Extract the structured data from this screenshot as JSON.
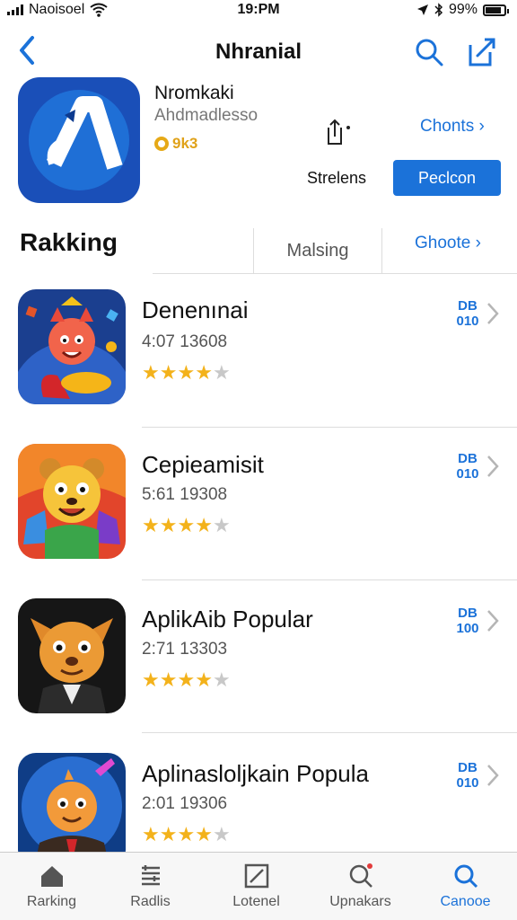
{
  "status_bar": {
    "carrier": "Naoisoel",
    "time": "19:PM",
    "battery": "99%",
    "icons": [
      "signal-bars-icon",
      "wifi-icon",
      "location-arrow-icon",
      "bluetooth-icon",
      "battery-icon"
    ]
  },
  "nav": {
    "title": "Nhranial",
    "icons": [
      "chevron-left-icon",
      "search-icon",
      "compose-icon"
    ]
  },
  "hero": {
    "name": "Nromkaki",
    "subtitle": "Ahdmadlesso",
    "rating": "9k3",
    "link_label": "Chonts",
    "secondary_label": "Strelens",
    "button_label": "Peclcon",
    "icon_name": "app-logo-icon"
  },
  "section": {
    "title": "Rakking",
    "segment_middle": "Malsing",
    "segment_right": "Ghoote"
  },
  "apps": [
    {
      "name": "Denenınai",
      "meta": "4:07 13608",
      "rating": 3.5,
      "badge_top": "DB",
      "badge_bottom": "010",
      "icon": "jester-game-icon"
    },
    {
      "name": "Cepieamisit",
      "meta": "5:61 19308",
      "rating": 4,
      "badge_top": "DB",
      "badge_bottom": "010",
      "icon": "bear-game-icon"
    },
    {
      "name": "AplikAib Popular",
      "meta": "2:71 13303",
      "rating": 4,
      "badge_top": "DB",
      "badge_bottom": "100",
      "icon": "fox-game-icon"
    },
    {
      "name": "Aplinasloljkain Popula",
      "meta": "2:01 19306",
      "rating": 4,
      "badge_top": "DB",
      "badge_bottom": "010",
      "icon": "hero-game-icon"
    }
  ],
  "tabbar": [
    {
      "label": "Rarking",
      "icon": "home-icon",
      "active": false
    },
    {
      "label": "Radlis",
      "icon": "list-icon",
      "active": false
    },
    {
      "label": "Lotenel",
      "icon": "edit-square-icon",
      "active": false
    },
    {
      "label": "Upnakars",
      "icon": "search-notify-icon",
      "active": false
    },
    {
      "label": "Canooe",
      "icon": "search-icon",
      "active": true
    }
  ],
  "colors": {
    "accent": "#1b72d9",
    "star": "#f3b21b",
    "hero_icon_bg": "#1a4fb8"
  }
}
